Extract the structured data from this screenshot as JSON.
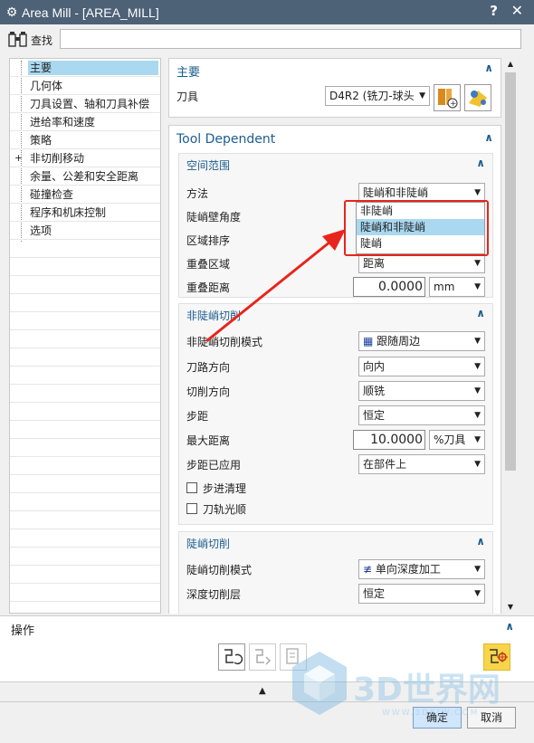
{
  "window": {
    "title": "Area Mill - [AREA_MILL]",
    "help": "?",
    "close": "✕"
  },
  "find": {
    "label": "查找",
    "value": ""
  },
  "tree": {
    "items": [
      {
        "label": "主要",
        "selected": true
      },
      {
        "label": "几何体"
      },
      {
        "label": "刀具设置、轴和刀具补偿"
      },
      {
        "label": "进给率和速度"
      },
      {
        "label": "策略"
      },
      {
        "label": "非切削移动",
        "expander": "+"
      },
      {
        "label": "余量、公差和安全距离"
      },
      {
        "label": "碰撞检查"
      },
      {
        "label": "程序和机床控制"
      },
      {
        "label": "选项"
      }
    ]
  },
  "main_group": {
    "title": "主要",
    "tool_label": "刀具",
    "tool_value": "D4R2 (铣刀-球头"
  },
  "tool_dependent": {
    "title": "Tool Dependent",
    "space_range": {
      "title": "空间范围",
      "method_label": "方法",
      "method_value": "陡峭和非陡峭",
      "wall_angle_label": "陡峭壁角度",
      "region_order_label": "区域排序",
      "overlap_label": "重叠区域",
      "overlap_value": "距离",
      "overlap_dist_label": "重叠距离",
      "overlap_dist_value": "0.0000",
      "overlap_dist_unit": "mm"
    },
    "non_steep": {
      "title": "非陡峭切削",
      "mode_label": "非陡峭切削模式",
      "mode_value": "跟随周边",
      "path_dir_label": "刀路方向",
      "path_dir_value": "向内",
      "cut_dir_label": "切削方向",
      "cut_dir_value": "顺铣",
      "stepover_label": "步距",
      "stepover_value": "恒定",
      "max_dist_label": "最大距离",
      "max_dist_value": "10.0000",
      "max_dist_unit": "%刀具",
      "applied_label": "步距已应用",
      "applied_value": "在部件上",
      "chk1_label": "步进清理",
      "chk2_label": "刀轨光顺"
    },
    "steep": {
      "title": "陡峭切削",
      "mode_label": "陡峭切削模式",
      "mode_value": "单向深度加工",
      "depth_label": "深度切削层",
      "depth_value": "恒定"
    }
  },
  "dropdown_popup": {
    "options": [
      "非陡峭",
      "陡峭和非陡峭",
      "陡峭"
    ],
    "highlighted": "陡峭和非陡峭"
  },
  "operations": {
    "title": "操作"
  },
  "buttons": {
    "ok": "确定",
    "cancel": "取消"
  },
  "watermark": {
    "text": "3D世界网",
    "url": "WWW.3DSJW.COM"
  },
  "colors": {
    "titlebar": "#4d6177",
    "accent": "#1d5d8f",
    "highlight": "#a9d8f0",
    "annotation": "#e8241c"
  }
}
